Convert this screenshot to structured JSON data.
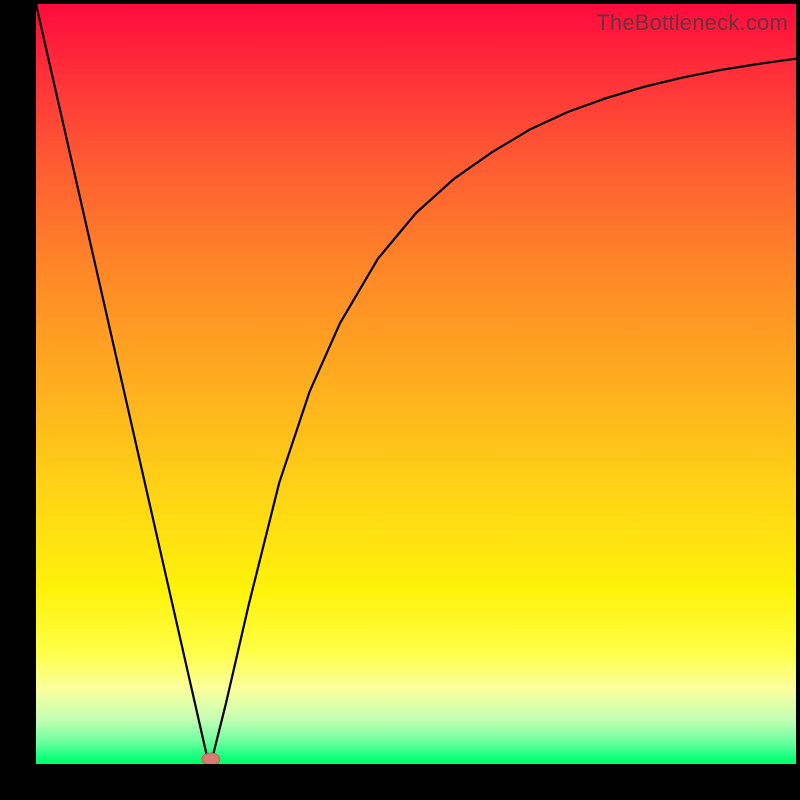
{
  "watermark": "TheBottleneck.com",
  "chart_data": {
    "type": "line",
    "title": "",
    "xlabel": "",
    "ylabel": "",
    "xlim": [
      0,
      1
    ],
    "ylim": [
      0,
      1
    ],
    "grid": false,
    "legend": false,
    "background_gradient_stops": [
      {
        "pos": 0.0,
        "color": "#ff0a3e"
      },
      {
        "pos": 0.08,
        "color": "#ff2b3a"
      },
      {
        "pos": 0.2,
        "color": "#ff5833"
      },
      {
        "pos": 0.34,
        "color": "#ff8428"
      },
      {
        "pos": 0.5,
        "color": "#ffae1f"
      },
      {
        "pos": 0.64,
        "color": "#ffd316"
      },
      {
        "pos": 0.77,
        "color": "#fff20a"
      },
      {
        "pos": 0.85,
        "color": "#fffe45"
      },
      {
        "pos": 0.9,
        "color": "#fbff9b"
      },
      {
        "pos": 0.94,
        "color": "#c7ffb4"
      },
      {
        "pos": 0.97,
        "color": "#6fffa0"
      },
      {
        "pos": 0.99,
        "color": "#17ff7d"
      },
      {
        "pos": 1.0,
        "color": "#00ff66"
      }
    ],
    "series": [
      {
        "name": "bottleneck-curve",
        "x": [
          0.0,
          0.05,
          0.1,
          0.15,
          0.2,
          0.225,
          0.23,
          0.25,
          0.28,
          0.32,
          0.36,
          0.4,
          0.45,
          0.5,
          0.55,
          0.6,
          0.65,
          0.7,
          0.75,
          0.8,
          0.85,
          0.9,
          0.95,
          1.0
        ],
        "y": [
          1.0,
          0.78,
          0.56,
          0.34,
          0.12,
          0.01,
          0.0,
          0.08,
          0.21,
          0.37,
          0.49,
          0.58,
          0.665,
          0.725,
          0.77,
          0.805,
          0.835,
          0.858,
          0.876,
          0.891,
          0.903,
          0.913,
          0.921,
          0.928
        ]
      }
    ],
    "marker": {
      "x": 0.23,
      "y": 0.0,
      "name": "optimal-point"
    }
  }
}
